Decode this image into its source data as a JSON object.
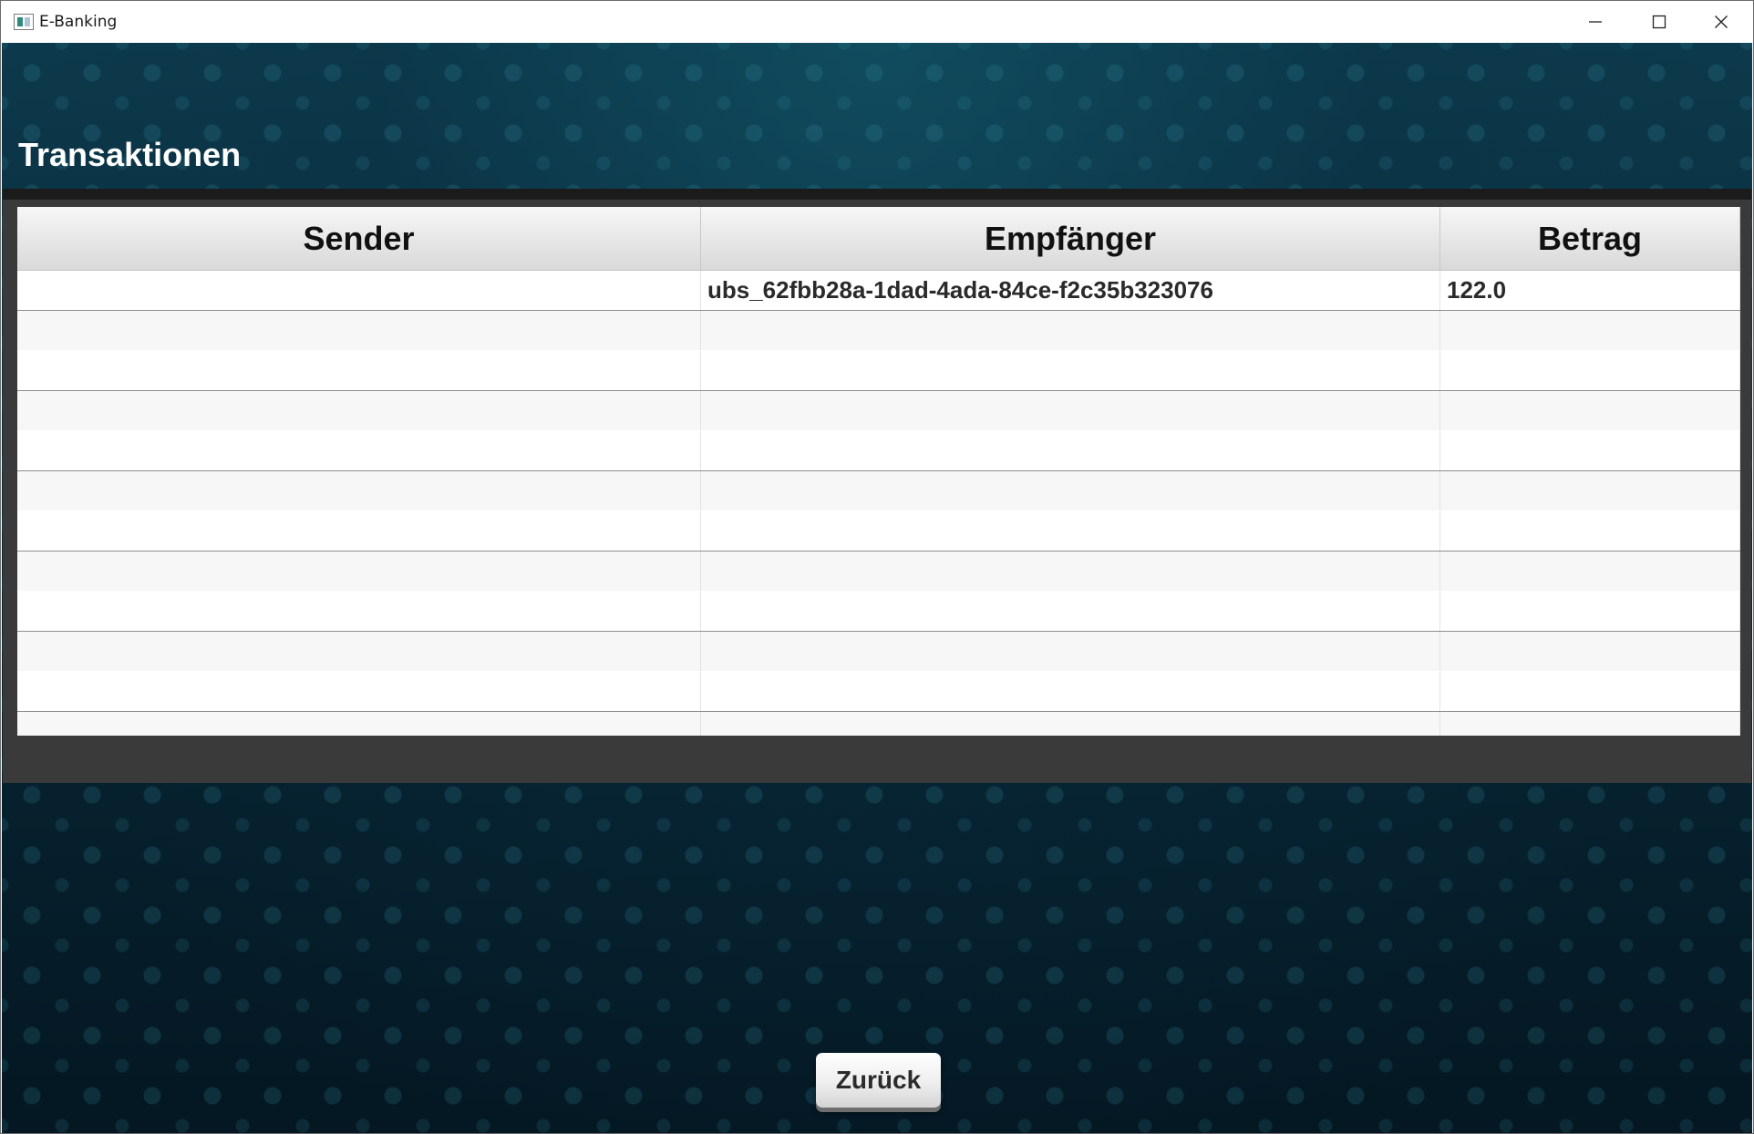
{
  "window": {
    "title": "E-Banking"
  },
  "page": {
    "title": "Transaktionen"
  },
  "table": {
    "columns": [
      "Sender",
      "Empfänger",
      "Betrag"
    ],
    "rows": [
      [
        "",
        "ubs_62fbb28a-1dad-4ada-84ce-f2c35b323076",
        "122.0"
      ],
      [
        "",
        "",
        ""
      ],
      [
        "",
        "",
        ""
      ],
      [
        "",
        "",
        ""
      ],
      [
        "",
        "",
        ""
      ],
      [
        "",
        "",
        ""
      ],
      [
        "",
        "",
        ""
      ],
      [
        "",
        "",
        ""
      ],
      [
        "",
        "",
        ""
      ],
      [
        "",
        "",
        ""
      ],
      [
        "",
        "",
        ""
      ],
      [
        "",
        "",
        ""
      ]
    ]
  },
  "actions": {
    "back_label": "Zurück"
  },
  "colors": {
    "background": "#0b2a38",
    "title_text": "#ffffff",
    "header_bg": "#e6e6e6"
  }
}
